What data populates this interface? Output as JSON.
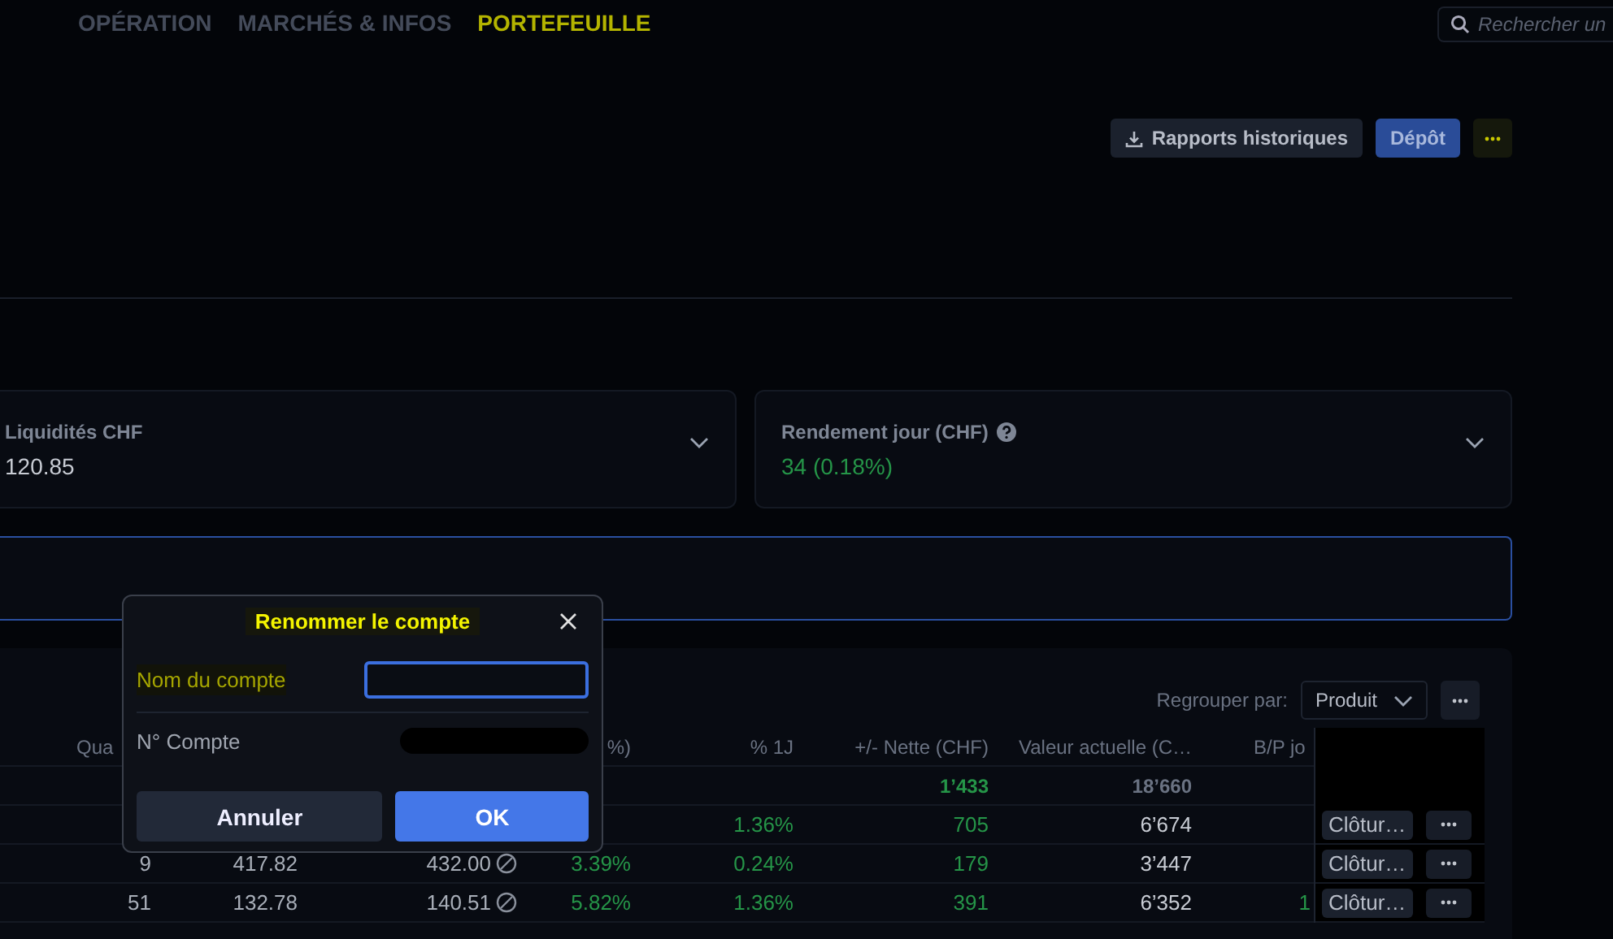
{
  "nav": [
    {
      "label": "OPÉRATION",
      "selected": false
    },
    {
      "label": "MARCHÉS & INFOS",
      "selected": false
    },
    {
      "label": "PORTEFEUILLE",
      "selected": true
    }
  ],
  "search": {
    "placeholder": "Rechercher un"
  },
  "actions": [
    {
      "kind": "download",
      "label": "Rapports historiques"
    },
    {
      "kind": "primary",
      "label": "Dépôt"
    },
    {
      "kind": "more"
    }
  ],
  "cards": [
    {
      "label": "Liquidités CHF",
      "value": "120.85",
      "help": false,
      "kind": "amount"
    },
    {
      "label": "Rendement jour (CHF)",
      "value": "34 (0.18%)",
      "help": true,
      "kind": "change"
    }
  ],
  "table": {
    "group_label": "Regrouper par:",
    "group_value": "Produit",
    "columns": [
      {
        "label": "Qua",
        "kind": "number"
      },
      {
        "kind": "number"
      },
      {
        "kind": "price"
      },
      {
        "label": "%)",
        "kind": "change"
      },
      {
        "label": "% 1J",
        "kind": "change"
      },
      {
        "label": "+/- Nette (CHF)",
        "kind": "change"
      },
      {
        "label": "Valeur actuelle (C…",
        "kind": "value"
      },
      {
        "label": "B/P jo",
        "kind": "change"
      }
    ],
    "totals": {
      "column_6": "1’433",
      "column_7": "18’660"
    },
    "rows": [
      {
        "cells": {
          "column_5": "1.36%",
          "column_6": "705",
          "column_7": "6’674"
        },
        "action": "Clôtur…"
      },
      {
        "cells": {
          "column_1": "9",
          "column_2": "417.82",
          "column_3": "432.00",
          "column_4": "3.39%",
          "column_5": "0.24%",
          "column_6": "179",
          "column_7": "3’447"
        },
        "action": "Clôtur…"
      },
      {
        "cells": {
          "column_1": "51",
          "column_2": "132.78",
          "column_3": "140.51",
          "column_4": "5.82%",
          "column_5": "1.36%",
          "column_6": "391",
          "column_7": "6’352",
          "column_8": "1"
        },
        "action": "Clôtur…"
      }
    ]
  },
  "dialog": {
    "title": "Renommer le compte",
    "name_label": "Nom du compte",
    "number_label": "N° Compte",
    "buttons": [
      {
        "kind": "cancel",
        "label": "Annuler"
      },
      {
        "kind": "confirm",
        "label": "OK"
      }
    ]
  }
}
